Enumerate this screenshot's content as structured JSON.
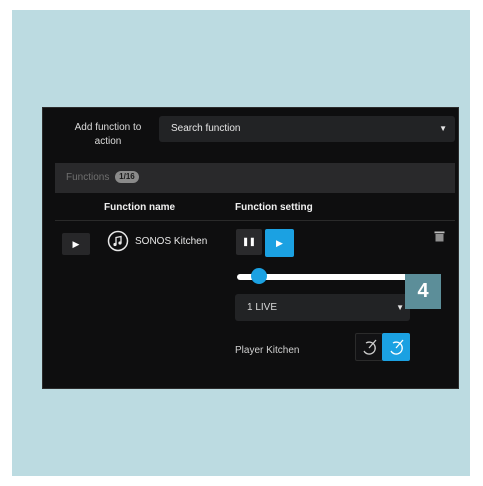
{
  "panel": {
    "add_label": "Add function to action",
    "search_placeholder": "Search function"
  },
  "functions": {
    "label": "Functions",
    "count": "1/16"
  },
  "columns": {
    "name": "Function name",
    "setting": "Function setting"
  },
  "row": {
    "name": "SONOS Kitchen",
    "volume_level": 0.08,
    "source_selected": "1 LIVE",
    "player_label": "Player Kitchen",
    "player_power_on": true
  },
  "callout": "4",
  "colors": {
    "accent": "#1ba1e2",
    "panel_bg": "#0e0e0f",
    "backdrop": "#bcdbe1",
    "callout_bg": "#5c8e99"
  },
  "icons": [
    "play-icon",
    "music-note-icon",
    "pause-icon",
    "trash-icon",
    "power-icon",
    "caret-down-icon"
  ]
}
